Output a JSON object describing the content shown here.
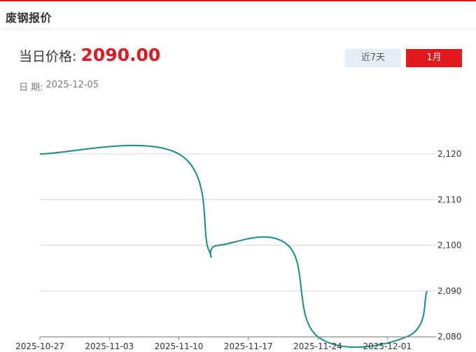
{
  "header": {
    "title": "废钢报价"
  },
  "price": {
    "label": "当日价格:",
    "value": "2090.00"
  },
  "date": {
    "label": "日 期:",
    "value": "2025-12-05"
  },
  "range_buttons": [
    {
      "label": "近7天",
      "active": false
    },
    {
      "label": "1月",
      "active": true
    }
  ],
  "colors": {
    "accent": "#e1191e",
    "line": "#1a8a8a",
    "inactive_button": "#e5eef7"
  },
  "chart_data": {
    "type": "line",
    "title": "",
    "xlabel": "",
    "ylabel": "",
    "x_ticks": [
      "2025-10-27",
      "2025-11-03",
      "2025-11-10",
      "2025-11-17",
      "2025-11-24",
      "2025-12-01"
    ],
    "y_ticks": [
      "2,080",
      "2,090",
      "2,100",
      "2,110",
      "2,120"
    ],
    "ylim": [
      2080,
      2120
    ],
    "xlim": [
      "2025-10-27",
      "2025-12-05"
    ],
    "grid": "horizontal",
    "series": [
      {
        "x": [
          "2025-10-27",
          "2025-11-10",
          "2025-11-13",
          "2025-11-14",
          "2025-11-21",
          "2025-11-24",
          "2025-12-03",
          "2025-12-05"
        ],
        "values": [
          2120,
          2120,
          2099,
          2100,
          2100,
          2080,
          2080,
          2090
        ]
      }
    ]
  }
}
